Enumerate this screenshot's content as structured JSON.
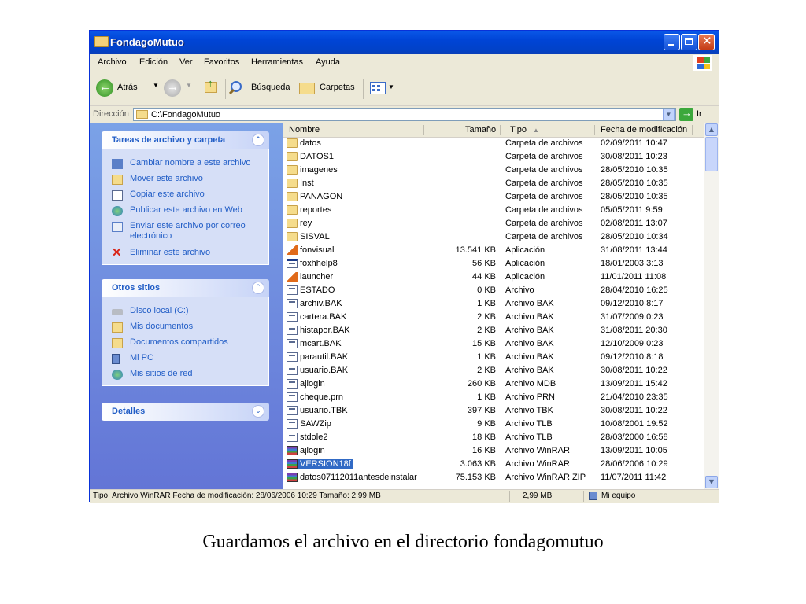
{
  "window": {
    "title": "FondagoMutuo"
  },
  "menu": [
    "Archivo",
    "Edición",
    "Ver",
    "Favoritos",
    "Herramientas",
    "Ayuda"
  ],
  "toolbar": {
    "back": "Atrás",
    "search": "Búsqueda",
    "folders": "Carpetas"
  },
  "address": {
    "label": "Dirección",
    "value": "C:\\FondagoMutuo",
    "go": "Ir"
  },
  "tasks": {
    "title": "Tareas de archivo y carpeta",
    "items": [
      {
        "label": "Cambiar nombre a este archivo",
        "icon": "rename-icon"
      },
      {
        "label": "Mover este archivo",
        "icon": "move-icon"
      },
      {
        "label": "Copiar este archivo",
        "icon": "copy-icon"
      },
      {
        "label": "Publicar este archivo en Web",
        "icon": "publish-icon"
      },
      {
        "label": "Enviar este archivo por correo electrónico",
        "icon": "email-icon"
      },
      {
        "label": "Eliminar este archivo",
        "icon": "delete-icon"
      }
    ]
  },
  "other_places": {
    "title": "Otros sitios",
    "items": [
      {
        "label": "Disco local (C:)",
        "icon": "drive-icon"
      },
      {
        "label": "Mis documentos",
        "icon": "my-documents-icon"
      },
      {
        "label": "Documentos compartidos",
        "icon": "shared-folder-icon"
      },
      {
        "label": "Mi PC",
        "icon": "my-computer-icon"
      },
      {
        "label": "Mis sitios de red",
        "icon": "network-icon"
      }
    ]
  },
  "details": {
    "title": "Detalles"
  },
  "columns": {
    "name": "Nombre",
    "size": "Tamaño",
    "type": "Tipo",
    "date": "Fecha de modificación"
  },
  "files": [
    {
      "name": "datos",
      "size": "",
      "type": "Carpeta de archivos",
      "date": "02/09/2011 10:47",
      "icon": "folder"
    },
    {
      "name": "DATOS1",
      "size": "",
      "type": "Carpeta de archivos",
      "date": "30/08/2011 10:23",
      "icon": "folder"
    },
    {
      "name": "imagenes",
      "size": "",
      "type": "Carpeta de archivos",
      "date": "28/05/2010 10:35",
      "icon": "folder"
    },
    {
      "name": "Inst",
      "size": "",
      "type": "Carpeta de archivos",
      "date": "28/05/2010 10:35",
      "icon": "folder"
    },
    {
      "name": "PANAGON",
      "size": "",
      "type": "Carpeta de archivos",
      "date": "28/05/2010 10:35",
      "icon": "folder"
    },
    {
      "name": "reportes",
      "size": "",
      "type": "Carpeta de archivos",
      "date": "05/05/2011 9:59",
      "icon": "folder"
    },
    {
      "name": "rey",
      "size": "",
      "type": "Carpeta de archivos",
      "date": "02/08/2011 13:07",
      "icon": "folder"
    },
    {
      "name": "SISVAL",
      "size": "",
      "type": "Carpeta de archivos",
      "date": "28/05/2010 10:34",
      "icon": "folder"
    },
    {
      "name": "fonvisual",
      "size": "13.541 KB",
      "type": "Aplicación",
      "date": "31/08/2011 13:44",
      "icon": "app"
    },
    {
      "name": "foxhhelp8",
      "size": "56 KB",
      "type": "Aplicación",
      "date": "18/01/2003 3:13",
      "icon": "window"
    },
    {
      "name": "launcher",
      "size": "44 KB",
      "type": "Aplicación",
      "date": "11/01/2011 11:08",
      "icon": "app"
    },
    {
      "name": "ESTADO",
      "size": "0 KB",
      "type": "Archivo",
      "date": "28/04/2010 16:25",
      "icon": "doc"
    },
    {
      "name": "archiv.BAK",
      "size": "1 KB",
      "type": "Archivo BAK",
      "date": "09/12/2010 8:17",
      "icon": "doc"
    },
    {
      "name": "cartera.BAK",
      "size": "2 KB",
      "type": "Archivo BAK",
      "date": "31/07/2009 0:23",
      "icon": "doc"
    },
    {
      "name": "histapor.BAK",
      "size": "2 KB",
      "type": "Archivo BAK",
      "date": "31/08/2011 20:30",
      "icon": "doc"
    },
    {
      "name": "mcart.BAK",
      "size": "15 KB",
      "type": "Archivo BAK",
      "date": "12/10/2009 0:23",
      "icon": "doc"
    },
    {
      "name": "parautil.BAK",
      "size": "1 KB",
      "type": "Archivo BAK",
      "date": "09/12/2010 8:18",
      "icon": "doc"
    },
    {
      "name": "usuario.BAK",
      "size": "2 KB",
      "type": "Archivo BAK",
      "date": "30/08/2011 10:22",
      "icon": "doc"
    },
    {
      "name": "ajlogin",
      "size": "260 KB",
      "type": "Archivo MDB",
      "date": "13/09/2011 15:42",
      "icon": "doc"
    },
    {
      "name": "cheque.prn",
      "size": "1 KB",
      "type": "Archivo PRN",
      "date": "21/04/2010 23:35",
      "icon": "doc"
    },
    {
      "name": "usuario.TBK",
      "size": "397 KB",
      "type": "Archivo TBK",
      "date": "30/08/2011 10:22",
      "icon": "doc"
    },
    {
      "name": "SAWZip",
      "size": "9 KB",
      "type": "Archivo TLB",
      "date": "10/08/2001 19:52",
      "icon": "doc"
    },
    {
      "name": "stdole2",
      "size": "18 KB",
      "type": "Archivo TLB",
      "date": "28/03/2000 16:58",
      "icon": "doc"
    },
    {
      "name": "ajlogin",
      "size": "16 KB",
      "type": "Archivo WinRAR",
      "date": "13/09/2011 10:05",
      "icon": "rar"
    },
    {
      "name": "VERSION18f",
      "size": "3.063 KB",
      "type": "Archivo WinRAR",
      "date": "28/06/2006 10:29",
      "icon": "rar",
      "selected": true
    },
    {
      "name": "datos07112011antesdeinstalar",
      "size": "75.153 KB",
      "type": "Archivo WinRAR ZIP",
      "date": "11/07/2011 11:42",
      "icon": "rar"
    }
  ],
  "status": {
    "info": "Tipo: Archivo WinRAR Fecha de modificación: 28/06/2006 10:29 Tamaño: 2,99 MB",
    "size": "2,99 MB",
    "location": "Mi equipo"
  },
  "caption": "Guardamos el archivo en el directorio fondagomutuo"
}
